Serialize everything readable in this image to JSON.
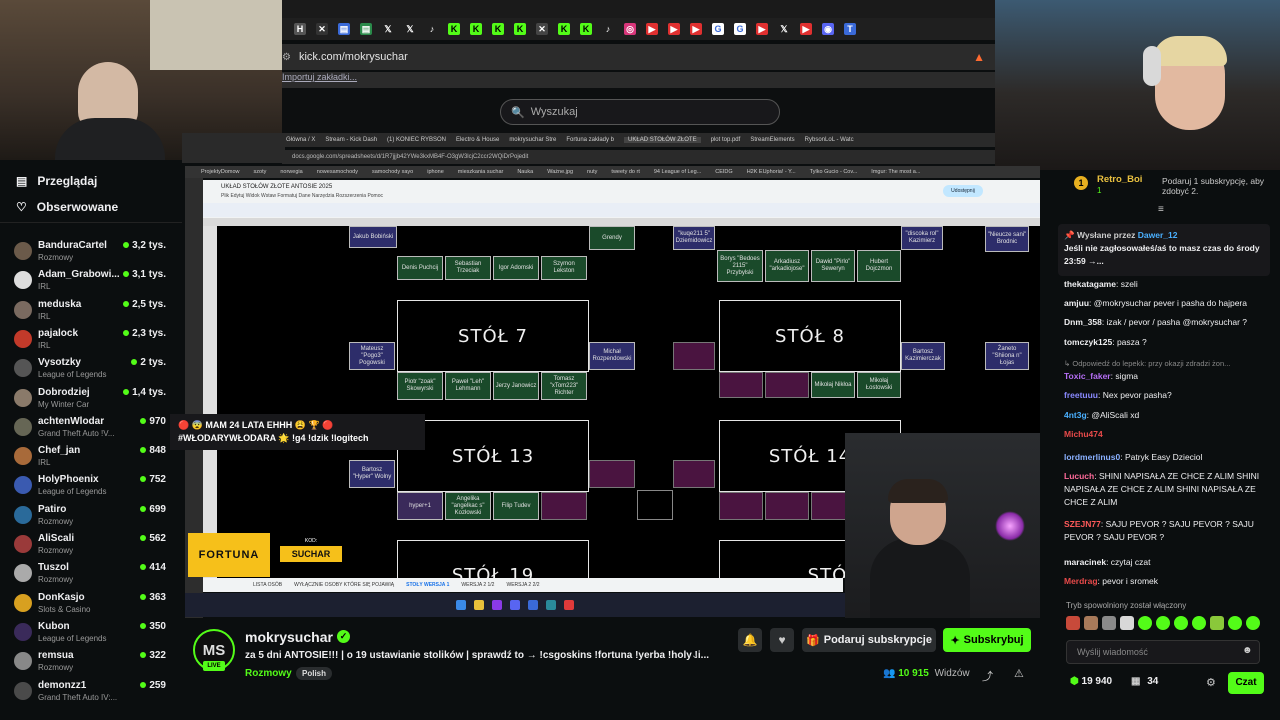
{
  "browser": {
    "url": "kick.com/mokrysuchar",
    "bookmark": "Importuj zakładki...",
    "search_placeholder": "Wyszukaj"
  },
  "inner_browser": {
    "tabs": [
      "Główna / X",
      "Stream - Kick Dash",
      "(1) KONIEC RYBSON",
      "Electro & House",
      "mokrysuchar Stre",
      "Fortuna zakłady b",
      "UKŁAD STOŁÓW ZŁOTE",
      "plot top.pdf",
      "StreamElements",
      "RybsonLoL - Watc"
    ],
    "url": "docs.google.com/spreadsheets/d/1R7jjjb42YWe3kxMB4F-O3gW3lcjC2ccr2WQiDrPojedit",
    "bookmarks": [
      "ProjektyDomow",
      "szoty",
      "norwegia",
      "nowesamochody",
      "samochody xayo",
      "iphone",
      "mieszkania suchar",
      "Nauka",
      "Ważne.jpg",
      "nuty",
      "tweety do rt",
      "94 League of Leg...",
      "CEIDG",
      "H2K EUphoria! - Y...",
      "Tylko Gucio - Cov...",
      "Imgur: The most a..."
    ]
  },
  "sheet": {
    "title": "UKŁAD STOŁÓW ZŁOTE ANTOSIE 2025",
    "menu": "Plik  Edytuj  Widok  Wstaw  Formatuj  Dane  Narzędzia  Rozszerzenia  Pomoc",
    "share": "Udostępnij",
    "tables": [
      "STÓŁ 7",
      "STÓŁ 8",
      "STÓŁ 13",
      "STÓŁ 14",
      "STÓŁ 19",
      "STÓŁ 20"
    ],
    "seats": {
      "s1": "Jakub Bobiński",
      "s2": "Denis Puchcij",
      "s3": "Sebastian Trzeciak",
      "s4": "Igor Adomski",
      "s5": "Szymon Lekston",
      "s6": "Grendy",
      "s7": "\"kuqe211 5\" Dziemidowicz",
      "s8": "Borys \"Bedoes 2115\" Przybylski",
      "s9": "Arkadiusz \"arkadiojose\"",
      "s10": "Dawid \"Pirlo\" Seweryn",
      "s11": "Hubert Dojczmon",
      "s12": "\"discoka rol\" Kazimierz",
      "s13": "\"Nieucze sani\" Brodnic",
      "s14": "Mateusz \"Pogo3\" Pogowski",
      "s15": "Piotr \"zoak\" Skowyrski",
      "s16": "Paweł \"Leh\" Lehmann",
      "s17": "Jerzy Janowicz",
      "s18": "Tomasz \"xTom223\" Richter",
      "s19": "Michał Rozpendowski",
      "s20": "Bartosz Kazimierczak",
      "s21": "Mikołaj Nikłoa",
      "s22": "Mikołaj Łostowski",
      "s23": "Żaneto \"Shiiona n\" Łojas",
      "s24": "Bartosz \"Hyper\" Wolny",
      "s25": "hyper+1",
      "s26": "Angelika \"angelkac s\" Kozłowski",
      "s27": "Filip Tudev"
    },
    "sheet_tabs": [
      "LISTA OSÓB",
      "WYŁĄCZNIE OSOBY KTÓRE SIĘ POJAWIĄ",
      "STOŁY WERSJA 1",
      "WERSJA 2 1/2",
      "WERSJA 2 2/2"
    ],
    "active_tab": "STOŁY WERSJA 1"
  },
  "sponsor": {
    "brand": "FORTUNA",
    "code_label": "KOD:",
    "code": "SUCHAR"
  },
  "sidebar": {
    "nav": [
      {
        "label": "Przeglądaj",
        "icon": "browse-icon"
      },
      {
        "label": "Obserwowane",
        "icon": "heart-icon"
      }
    ],
    "channels": [
      {
        "name": "BanduraCartel",
        "category": "Rozmowy",
        "viewers": "3,2 tys.",
        "color": "#6b5a4a"
      },
      {
        "name": "Adam_Grabowi...",
        "category": "IRL",
        "viewers": "3,1 tys.",
        "color": "#ddd"
      },
      {
        "name": "meduska",
        "category": "IRL",
        "viewers": "2,5 tys.",
        "color": "#7a6a60"
      },
      {
        "name": "pajalock",
        "category": "IRL",
        "viewers": "2,3 tys.",
        "color": "#c23a2a"
      },
      {
        "name": "Vysotzky",
        "category": "League of Legends",
        "viewers": "2 tys.",
        "color": "#555"
      },
      {
        "name": "Dobrodziej",
        "category": "My Winter Car",
        "viewers": "1,4 tys.",
        "color": "#8a7a6a"
      },
      {
        "name": "achtenWlodar",
        "category": "Grand Theft Auto !V...",
        "viewers": "970",
        "color": "#665"
      },
      {
        "name": "Chef_jan",
        "category": "IRL",
        "viewers": "848",
        "color": "#a86a3a"
      },
      {
        "name": "HolyPhoenix",
        "category": "League of Legends",
        "viewers": "752",
        "color": "#3a5ab0"
      },
      {
        "name": "Patiro",
        "category": "Rozmowy",
        "viewers": "699",
        "color": "#2a6a9a"
      },
      {
        "name": "AliScali",
        "category": "Rozmowy",
        "viewers": "562",
        "color": "#9a3a3a"
      },
      {
        "name": "Tuszol",
        "category": "Rozmowy",
        "viewers": "414",
        "color": "#aaa"
      },
      {
        "name": "DonKasjo",
        "category": "Slots & Casino",
        "viewers": "363",
        "color": "#d8a020"
      },
      {
        "name": "Kubon",
        "category": "League of Legends",
        "viewers": "350",
        "color": "#3a2a5a"
      },
      {
        "name": "remsua",
        "category": "Rozmowy",
        "viewers": "322",
        "color": "#888"
      },
      {
        "name": "demonzz1",
        "category": "Grand Theft Auto IV:...",
        "viewers": "259",
        "color": "#4a4a4a"
      }
    ],
    "tooltip_line1": "🔴 😨 MAM 24 LATA EHHH 😩 🏆 🔴",
    "tooltip_line2": "#WŁODARYWŁODARA 🌟 !g4 !dzik !logitech"
  },
  "stream": {
    "avatar_initials": "MS",
    "live": "LIVE",
    "channel": "mokrysuchar",
    "title": "za 5 dni ANTOSIE!!! | o 19 ustawianie stolików | sprawdź to → !csgoskins !fortuna !yerba !holy !i...",
    "category": "Rozmowy",
    "language": "Polish",
    "gift_label": "Podaruj subskrypcje",
    "subscribe_label": "Subskrybuj",
    "viewers": "10 915",
    "viewers_label": "Widzów"
  },
  "chat": {
    "top_gifter": "Retro_Boi",
    "top_gifter_count": "1",
    "gift_prompt": "Podaruj 1 subskrypcję, aby zdobyć 2.",
    "pinned_by": "Wysłane przez",
    "pinned_user": "Dawer_12",
    "pinned_text": "Jeśli nie zagłosowałeś/aś to masz czas do środy 23:59 →...",
    "messages": [
      {
        "user": "thekatagame",
        "text": "szeli",
        "color": "#efeff1"
      },
      {
        "user": "amjuu",
        "text": "@mokrysuchar pever i pasha do hajpera",
        "color": "#efeff1"
      },
      {
        "user": "Dnm_358",
        "text": "izak / pevor / pasha @mokrysuchar ?",
        "color": "#efeff1"
      },
      {
        "user": "tomczyk125",
        "text": "pasza ?",
        "color": "#efeff1"
      },
      {
        "user": "",
        "text": "↳ Odpowiedź do lepekk: przy okazji zdradzi żon...",
        "color": "#888"
      },
      {
        "user": "Toxic_faker",
        "text": "sigma",
        "color": "#b56ef5"
      },
      {
        "user": "freetuuu",
        "text": "Nex pevor pasha?",
        "color": "#8a8aff"
      },
      {
        "user": "4nt3g",
        "text": "@AliScali xd",
        "color": "#4ab0ff"
      },
      {
        "user": "Michu474",
        "text": "",
        "color": "#e84a4a"
      },
      {
        "user": "lordmerlinus0",
        "text": "Patryk Easy Dzieciol",
        "color": "#8ab0ff"
      },
      {
        "user": "Lucuch",
        "text": "SHINI NAPISAŁA ZE CHCE Z ALIM  SHINI NAPISAŁA ZE CHCE Z ALIM  SHINI NAPISAŁA ZE CHCE Z ALIM",
        "color": "#ff6a9a"
      },
      {
        "user": "SZEJN77",
        "text": "SAJU PEVOR ?  SAJU PEVOR ?  SAJU PEVOR ?  SAJU PEVOR ?",
        "color": "#ff5a5a"
      },
      {
        "user": "maracinek",
        "text": "czytaj czat",
        "color": "#efeff1"
      },
      {
        "user": "Merdrag",
        "text": "pevor i sromek",
        "color": "#e84a4a"
      }
    ],
    "slow_mode": "Tryb spowolniony został włączony",
    "input_placeholder": "Wyślij wiadomość",
    "points": "19 940",
    "count2": "34",
    "send_label": "Czat"
  }
}
